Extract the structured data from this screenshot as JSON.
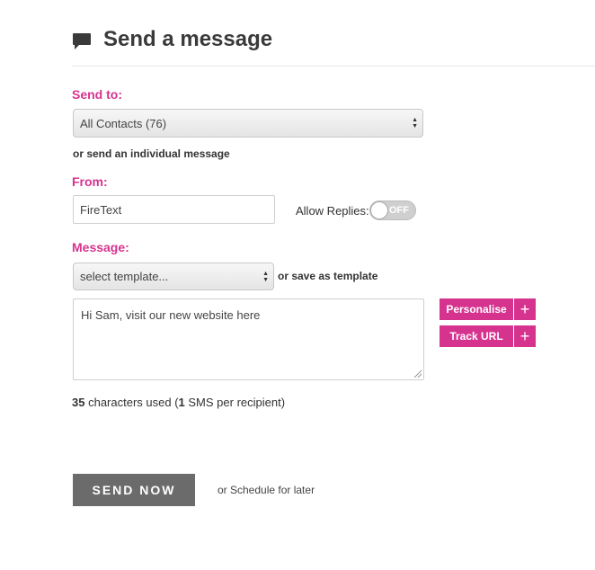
{
  "header": {
    "title": "Send a message",
    "icon": "speech-bubble-icon"
  },
  "send_to": {
    "label": "Send to:",
    "selected": "All Contacts (76)",
    "individual_link": "or send an individual message"
  },
  "from": {
    "label": "From:",
    "value": "FireText",
    "allow_replies_label": "Allow Replies:",
    "toggle_state": "OFF"
  },
  "message": {
    "label": "Message:",
    "template_selected": "select template...",
    "save_template_link": "or save as template",
    "body": "Hi Sam, visit our new website here",
    "personalise_label": "Personalise",
    "track_url_label": "Track URL",
    "plus_symbol": "+",
    "chars_used": "35",
    "chars_used_text": "characters used (",
    "sms_count": "1",
    "sms_text": "SMS per recipient)"
  },
  "actions": {
    "send_now": "SEND NOW",
    "schedule_link": "or Schedule for later"
  },
  "colors": {
    "accent": "#d6338f",
    "button_dark": "#6b6b6b"
  }
}
